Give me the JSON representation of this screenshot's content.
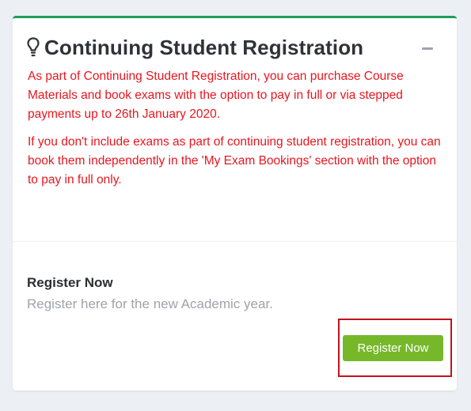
{
  "card": {
    "title": "Continuing Student Registration",
    "icons": {
      "header": "lightbulb-icon",
      "collapse": "minus-icon"
    },
    "notice": [
      "As part of Continuing Student Registration, you can purchase Course Materials and book exams with the option to pay in full or via stepped payments up to 26th January 2020.",
      "If you don't include exams as part of continuing student registration, you can book them independently in the 'My Exam Bookings' section with the option to pay in full only."
    ],
    "register": {
      "heading": "Register Now",
      "description": "Register here for the new Academic year.",
      "button_label": "Register Now"
    }
  },
  "colors": {
    "notice_text": "#e8161f",
    "accent_top_border": "#1e9e5a",
    "button": "#76b82a",
    "highlight_outline": "#c0141b"
  }
}
